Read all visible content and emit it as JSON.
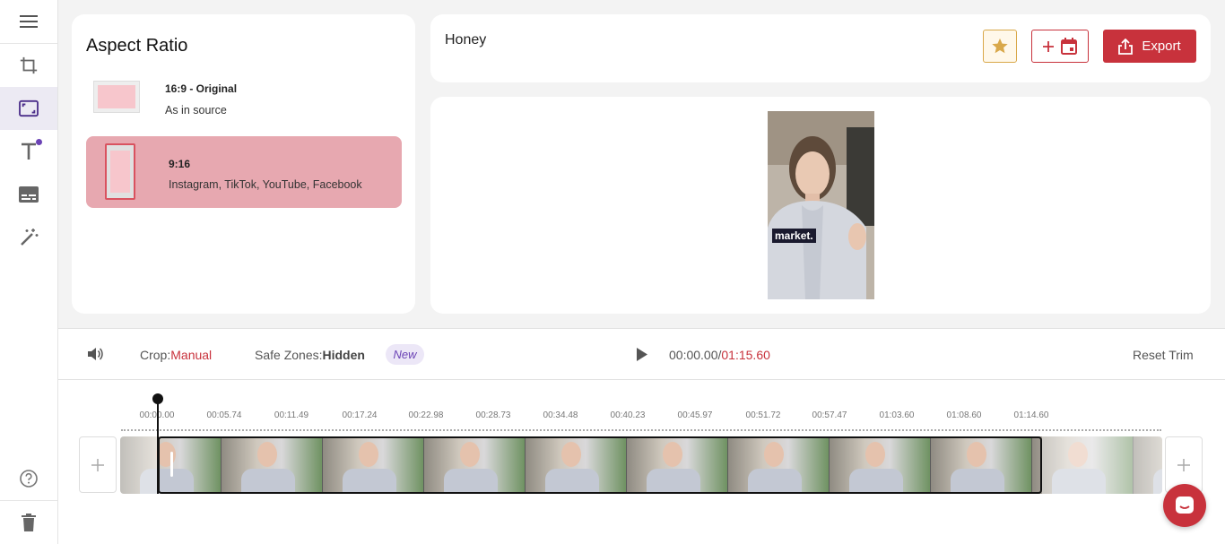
{
  "sidebar": {
    "items": [
      {
        "icon": "menu-icon"
      },
      {
        "icon": "crop-icon"
      },
      {
        "icon": "aspect-ratio-icon",
        "active": true
      },
      {
        "icon": "text-icon",
        "has_notification": true
      },
      {
        "icon": "subtitles-icon"
      },
      {
        "icon": "magic-wand-icon"
      },
      {
        "icon": "help-icon"
      },
      {
        "icon": "trash-icon"
      }
    ]
  },
  "aspect_panel": {
    "title": "Aspect Ratio",
    "options": [
      {
        "label": "16:9 - Original",
        "description": "As in source",
        "selected": false
      },
      {
        "label": "9:16",
        "description": "Instagram, TikTok, YouTube, Facebook",
        "selected": true
      }
    ]
  },
  "header": {
    "project_title": "Honey",
    "export_label": "Export"
  },
  "preview": {
    "caption": "market."
  },
  "controls": {
    "crop_label": "Crop",
    "crop_value": "Manual",
    "safe_zones_label": "Safe Zones",
    "safe_zones_value": "Hidden",
    "new_badge": "New",
    "current_time": "00:00.00",
    "separator": "/",
    "total_time": "01:15.60",
    "reset_trim": "Reset Trim"
  },
  "timeline": {
    "ticks": [
      "00:00.00",
      "00:05.74",
      "00:11.49",
      "00:17.24",
      "00:22.98",
      "00:28.73",
      "00:34.48",
      "00:40.23",
      "00:45.97",
      "00:51.72",
      "00:57.47",
      "01:03.60",
      "01:08.60",
      "01:14.60"
    ]
  },
  "colors": {
    "accent": "#c8323c",
    "selected_option": "#e7a8b0",
    "star": "#d9a84a",
    "badge": "#6b43b5"
  }
}
